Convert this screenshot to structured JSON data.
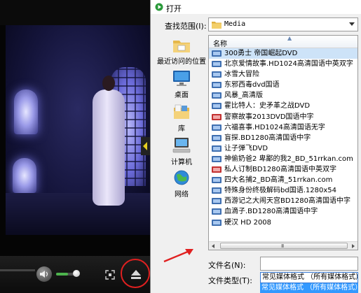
{
  "dialog": {
    "title": "打开",
    "look_in_label": "查找范围(I):",
    "look_in_value": "Media",
    "column_name": "名称",
    "file_name_label": "文件名(N):",
    "file_name_value": "",
    "file_type_label": "文件类型(T):",
    "file_type_value": "常见媒体格式 （所有媒体格式）",
    "file_type_option": "常见媒体格式 （所有媒体格式）",
    "scroll_grip": "III"
  },
  "places": [
    {
      "label": "最近访问的位置",
      "icon": "recent-places-icon"
    },
    {
      "label": "桌面",
      "icon": "desktop-icon"
    },
    {
      "label": "库",
      "icon": "libraries-icon"
    },
    {
      "label": "计算机",
      "icon": "computer-icon"
    },
    {
      "label": "网络",
      "icon": "network-icon"
    }
  ],
  "files": [
    {
      "name": "300勇士 帝国崛起DVD",
      "icon": "video-file-icon"
    },
    {
      "name": "北京爱情故事.HD1024高清国语中英双字",
      "icon": "video-file-icon"
    },
    {
      "name": "冰雪大冒险",
      "icon": "video-file-icon"
    },
    {
      "name": "东邪西毒dvd国语",
      "icon": "video-file-icon"
    },
    {
      "name": "风暴_高清版",
      "icon": "video-file-icon"
    },
    {
      "name": "霍比特人：史矛革之战DVD",
      "icon": "video-file-icon"
    },
    {
      "name": "警察故事2013DVD国语中字",
      "icon": "rm-file-icon"
    },
    {
      "name": "六福喜事.HD1024高清国语无字",
      "icon": "video-file-icon"
    },
    {
      "name": "盲探.BD1280高清国语中字",
      "icon": "video-file-icon"
    },
    {
      "name": "让子弹飞DVD",
      "icon": "video-file-icon"
    },
    {
      "name": "神偷奶爸2 卑鄙的我2_BD_51rrkan.com",
      "icon": "video-file-icon"
    },
    {
      "name": "私人订制BD1280高清国语中英双字",
      "icon": "rm-file-icon"
    },
    {
      "name": "四大名捕2_BD高清_51rrkan.com",
      "icon": "video-file-icon"
    },
    {
      "name": "特殊身份终极解码bd国语.1280x54",
      "icon": "video-file-icon"
    },
    {
      "name": "西游记之大闹天宫BD1280高清国语中字",
      "icon": "video-file-icon"
    },
    {
      "name": "血滴子.BD1280高清国语中字",
      "icon": "video-file-icon"
    },
    {
      "name": "硬汉 HD 2008",
      "icon": "video-file-icon"
    }
  ],
  "player": {
    "volume_level": 0.55
  },
  "colors": {
    "selection": "#cde3f8",
    "annotation": "#e02020",
    "highlight": "#3399ff"
  }
}
